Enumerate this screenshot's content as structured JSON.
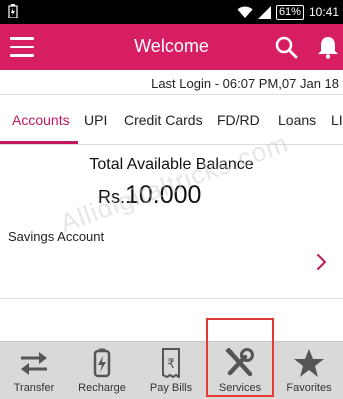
{
  "status_bar": {
    "battery": "61%",
    "time": "10:41",
    "icons": [
      "charging-icon",
      "wifi-icon",
      "signal-icon",
      "battery-icon"
    ]
  },
  "app_bar": {
    "title": "Welcome",
    "icons": [
      "menu-icon",
      "search-icon",
      "bell-icon"
    ],
    "color": "#d71e63"
  },
  "last_login": "Last Login - 06:07 PM,07 Jan 18",
  "tabs": [
    {
      "label": "Accounts",
      "active": true
    },
    {
      "label": "UPI"
    },
    {
      "label": "Credit Cards"
    },
    {
      "label": "FD/RD"
    },
    {
      "label": "Loans"
    },
    {
      "label": "LIM"
    }
  ],
  "balance": {
    "label": "Total Available Balance",
    "currency": "Rs.",
    "amount": "10.000"
  },
  "savings_account": {
    "label": "Savings Account",
    "icon": "chevron-right-icon"
  },
  "watermark": "Allidigitaltricks.com",
  "bottom_nav": [
    {
      "label": "Transfer",
      "icon": "transfer-icon"
    },
    {
      "label": "Recharge",
      "icon": "recharge-icon"
    },
    {
      "label": "Pay Bills",
      "icon": "pay-bills-icon"
    },
    {
      "label": "Services",
      "icon": "services-icon",
      "highlighted": true
    },
    {
      "label": "Favorites",
      "icon": "star-icon"
    }
  ],
  "colors": {
    "accent": "#c2185b",
    "highlight_box": "#e53935",
    "nav_background": "#d9d9d9"
  }
}
